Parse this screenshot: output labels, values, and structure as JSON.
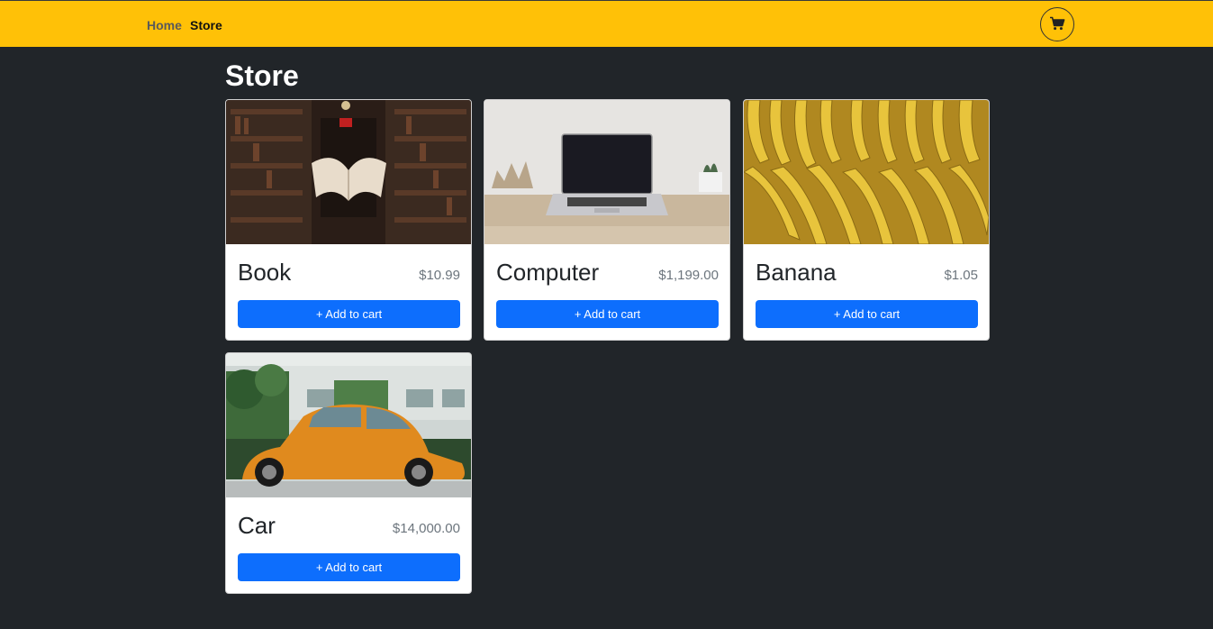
{
  "nav": {
    "home": "Home",
    "store": "Store",
    "cart_icon": "cart-icon",
    "bg_color": "#ffc107"
  },
  "page": {
    "title": "Store"
  },
  "products": [
    {
      "name": "Book",
      "price": "$10.99",
      "button": "+ Add to cart",
      "image": "floating-book-library-photo"
    },
    {
      "name": "Computer",
      "price": "$1,199.00",
      "button": "+ Add to cart",
      "image": "laptop-on-desk-photo"
    },
    {
      "name": "Banana",
      "price": "$1.05",
      "button": "+ Add to cart",
      "image": "bananas-bunch-photo"
    },
    {
      "name": "Car",
      "price": "$14,000.00",
      "button": "+ Add to cart",
      "image": "orange-beetle-car-photo"
    }
  ],
  "colors": {
    "background": "#212529",
    "button": "#0d6efd",
    "price": "#6c757d"
  }
}
